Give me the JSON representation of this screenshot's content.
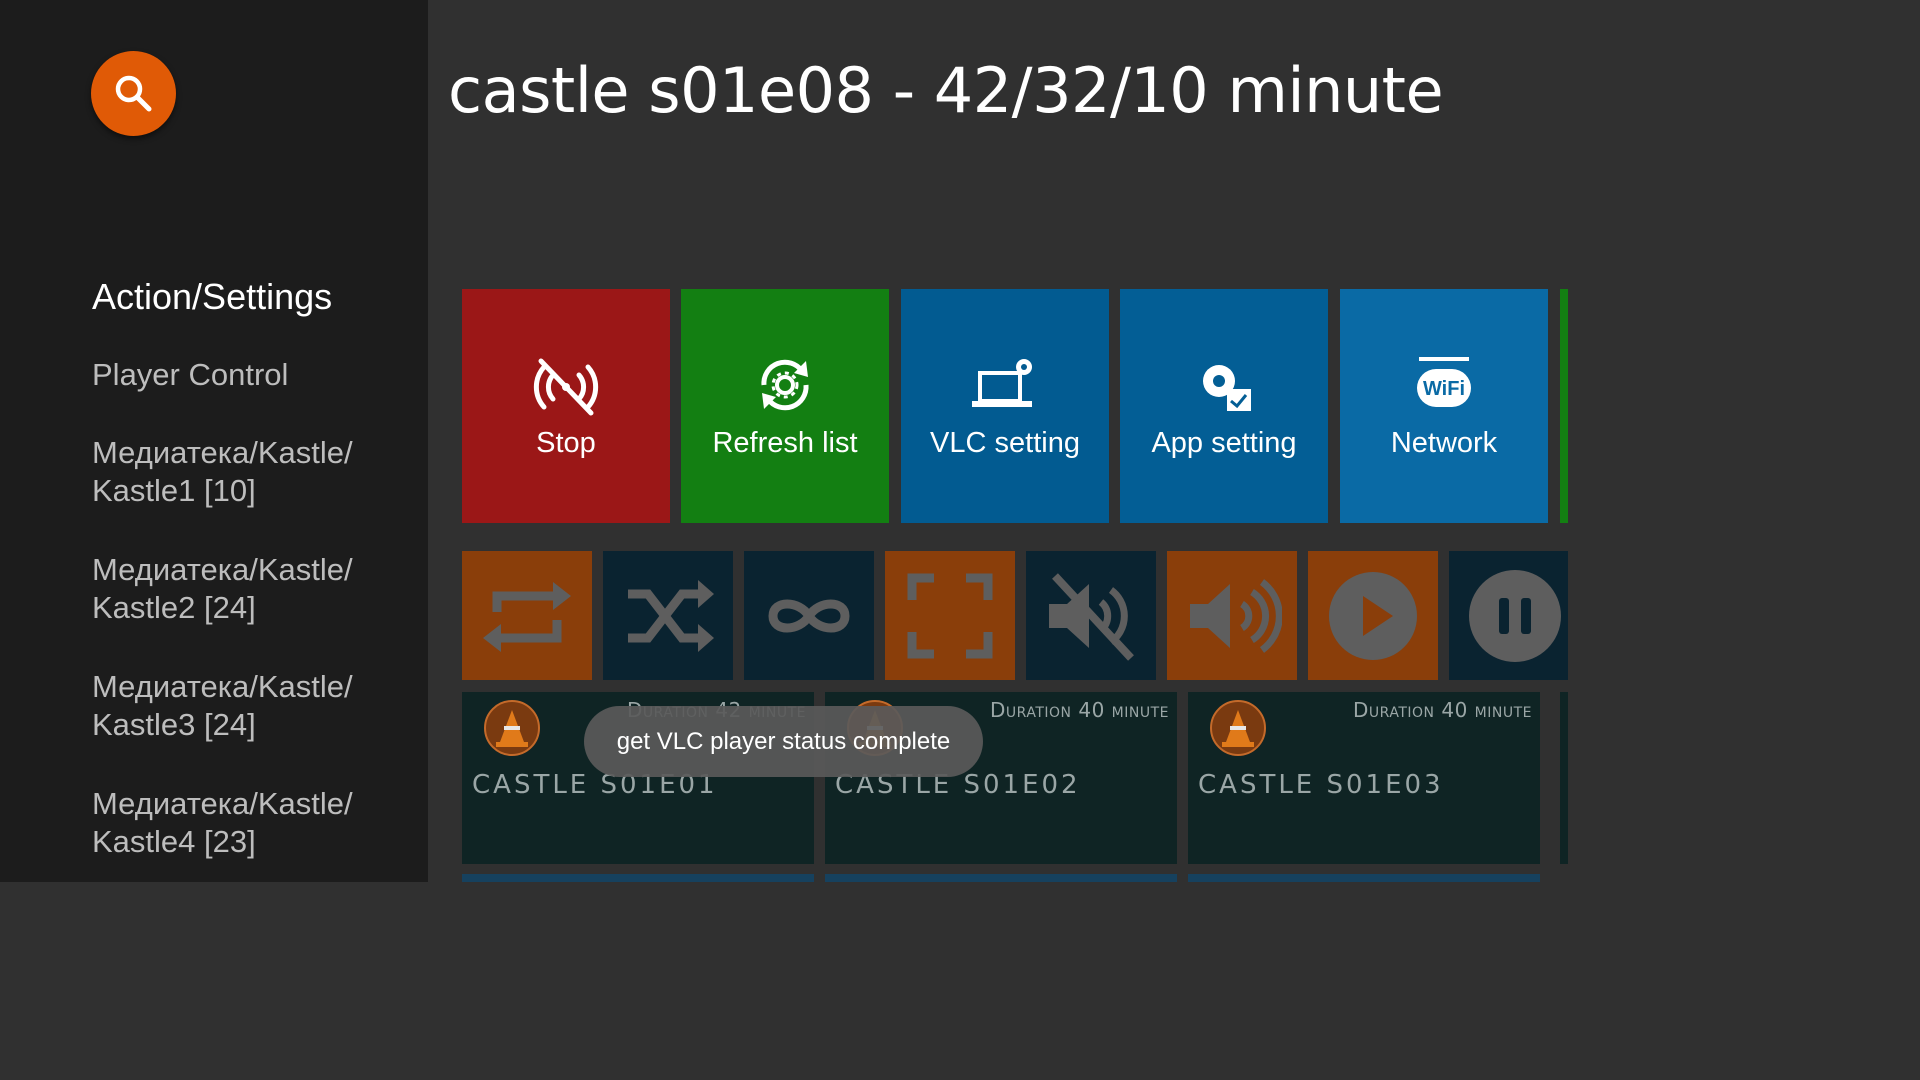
{
  "sidebar": {
    "search_icon": "search-icon",
    "section_title": "Action/Settings",
    "items": [
      {
        "line1": "Player Control",
        "line2": ""
      },
      {
        "line1": "Медиатека/Kastle/",
        "line2": "Kastle1 [10]"
      },
      {
        "line1": "Медиатека/Kastle/",
        "line2": "Kastle2 [24]"
      },
      {
        "line1": "Медиатека/Kastle/",
        "line2": "Kastle3 [24]"
      },
      {
        "line1": "Медиатека/Kastle/",
        "line2": "Kastle4 [23]"
      }
    ]
  },
  "main": {
    "title": "castle s01e08 - 42/32/10 minute",
    "actions": [
      {
        "label": "Stop",
        "icon": "stop-cast-icon",
        "color": "#9b1717"
      },
      {
        "label": "Refresh list",
        "icon": "refresh-icon",
        "color": "#137f12"
      },
      {
        "label": "VLC setting",
        "icon": "laptop-settings-icon",
        "color": "#025b91"
      },
      {
        "label": "App setting",
        "icon": "gear-check-icon",
        "color": "#035e95"
      },
      {
        "label": "Network",
        "icon": "wifi-icon",
        "color": "#0a6aa5"
      }
    ],
    "controls": [
      {
        "icon": "repeat-icon",
        "color": "#8a3e0a"
      },
      {
        "icon": "shuffle-icon",
        "color": "#0a2330"
      },
      {
        "icon": "loop-icon",
        "color": "#0a2330"
      },
      {
        "icon": "fullscreen-icon",
        "color": "#8a3e0a"
      },
      {
        "icon": "mute-icon",
        "color": "#0a2330"
      },
      {
        "icon": "volume-icon",
        "color": "#8a3e0a"
      },
      {
        "icon": "play-icon",
        "color": "#8a3e0a"
      },
      {
        "icon": "pause-icon",
        "color": "#0a2330"
      }
    ],
    "media": [
      {
        "duration": "Duration 42 minute",
        "title": "castle s01e01"
      },
      {
        "duration": "Duration 40 minute",
        "title": "castle s01e02"
      },
      {
        "duration": "Duration 40 minute",
        "title": "castle s01e03"
      }
    ]
  },
  "toast": {
    "text": "get VLC player status complete"
  }
}
